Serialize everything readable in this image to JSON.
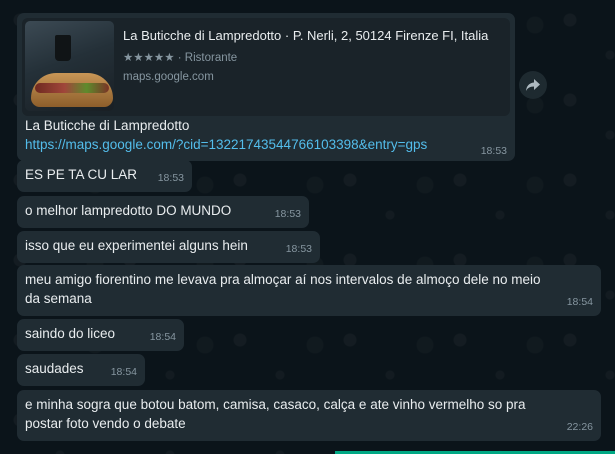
{
  "link_card": {
    "preview_title": "La Buticche di Lampredotto · P. Nerli, 2, 50124 Firenze FI, Italia",
    "stars": "★★★★★",
    "category": "· Ristorante",
    "domain": "maps.google.com",
    "name": "La Buticche di Lampredotto",
    "url": "https://maps.google.com/?cid=13221743544766103398&entry=gps",
    "time": "18:53"
  },
  "messages": [
    {
      "text": "ES PE TA CU LAR",
      "time": "18:53"
    },
    {
      "text": "o melhor lampredotto DO MUNDO",
      "time": "18:53"
    },
    {
      "text": "isso que eu experimentei alguns hein",
      "time": "18:53"
    },
    {
      "text": "meu amigo fiorentino me levava pra almoçar aí nos intervalos de almoço dele no meio da semana",
      "time": "18:54"
    },
    {
      "text": "saindo do liceo",
      "time": "18:54"
    },
    {
      "text": "saudades",
      "time": "18:54"
    },
    {
      "text": "e minha sogra que botou batom, camisa, casaco, calça e ate vinho vermelho so pra postar foto vendo o debate",
      "time": "22:26"
    }
  ],
  "colors": {
    "background": "#0b141a",
    "bubble": "#202c33",
    "link": "#53bdeb",
    "meta": "#8696a0",
    "accent": "#00a884"
  },
  "icons": {
    "forward": "forward-arrow-icon"
  }
}
